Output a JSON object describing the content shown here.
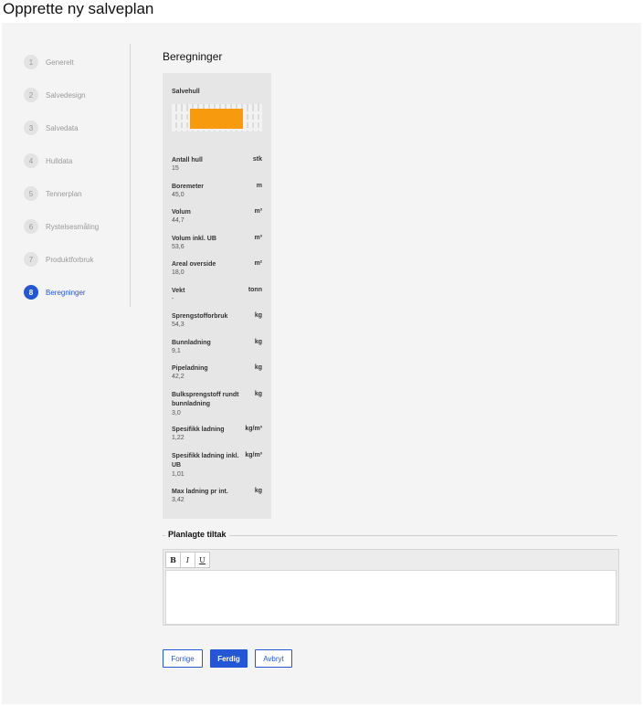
{
  "page": {
    "title": "Opprette ny salveplan"
  },
  "stepper": {
    "steps": [
      {
        "number": "1",
        "label": "Generelt",
        "active": false
      },
      {
        "number": "2",
        "label": "Salvedesign",
        "active": false
      },
      {
        "number": "3",
        "label": "Salvedata",
        "active": false
      },
      {
        "number": "4",
        "label": "Hulldata",
        "active": false
      },
      {
        "number": "5",
        "label": "Tennerplan",
        "active": false
      },
      {
        "number": "6",
        "label": "Rystelsesmåling",
        "active": false
      },
      {
        "number": "7",
        "label": "Produktforbruk",
        "active": false
      },
      {
        "number": "8",
        "label": "Beregninger",
        "active": true
      }
    ]
  },
  "section": {
    "title": "Beregninger"
  },
  "card": {
    "title": "Salvehull",
    "metrics": [
      {
        "label": "Antall hull",
        "unit": "stk",
        "value": "15"
      },
      {
        "label": "Boremeter",
        "unit": "m",
        "value": "45,0"
      },
      {
        "label": "Volum",
        "unit": "m³",
        "value": "44,7"
      },
      {
        "label": "Volum inkl. UB",
        "unit": "m³",
        "value": "53,6"
      },
      {
        "label": "Areal overside",
        "unit": "m²",
        "value": "18,0"
      },
      {
        "label": "Vekt",
        "unit": "tonn",
        "value": "-"
      },
      {
        "label": "Sprengstofforbruk",
        "unit": "kg",
        "value": "54,3"
      },
      {
        "label": "Bunnladning",
        "unit": "kg",
        "value": "9,1"
      },
      {
        "label": "Pipeladning",
        "unit": "kg",
        "value": "42,2"
      },
      {
        "label": "Bulksprengstoff rundt bunnladning",
        "unit": "kg",
        "value": "3,0"
      },
      {
        "label": "Spesifikk ladning",
        "unit": "kg/m³",
        "value": "1,22"
      },
      {
        "label": "Spesifikk ladning inkl. UB",
        "unit": "kg/m³",
        "value": "1,01"
      },
      {
        "label": "Max ladning pr int.",
        "unit": "kg",
        "value": "3,42"
      }
    ]
  },
  "tiltak": {
    "legend": "Planlagte tiltak",
    "toolbar": {
      "bold": "B",
      "italic": "I",
      "underline": "U"
    },
    "content": ""
  },
  "actions": {
    "previous": "Forrige",
    "done": "Ferdig",
    "cancel": "Avbryt"
  },
  "colors": {
    "accent": "#2457d6",
    "highlight": "#f79a0e",
    "panel": "#f4f4f4"
  }
}
